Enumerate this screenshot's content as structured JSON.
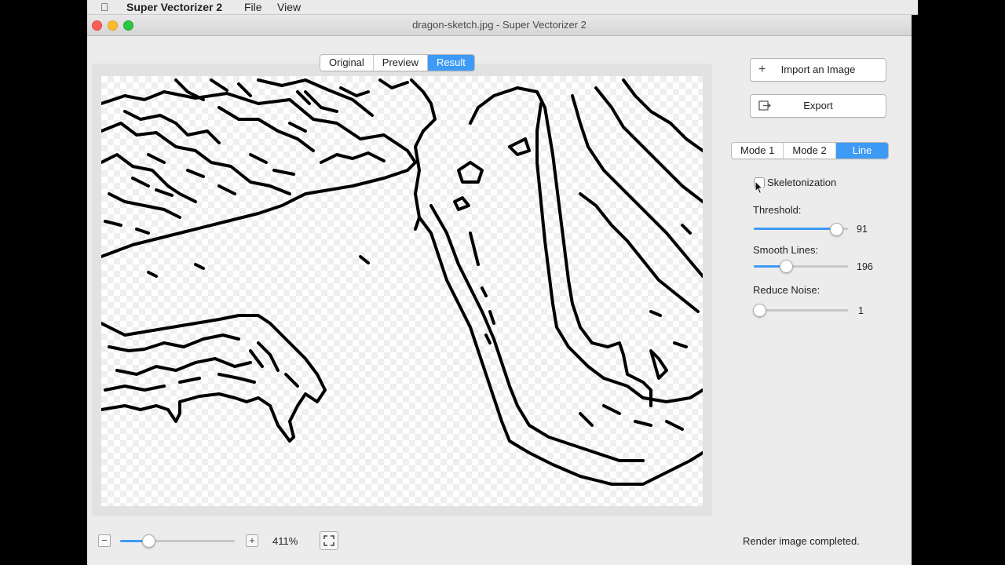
{
  "menubar": {
    "app_name": "Super Vectorizer 2",
    "menus": [
      "File",
      "View"
    ]
  },
  "window": {
    "title": "dragon-sketch.jpg - Super Vectorizer 2"
  },
  "view_tabs": {
    "items": [
      "Original",
      "Preview",
      "Result"
    ],
    "selected": "Result"
  },
  "actions": {
    "import_label": "Import an Image",
    "export_label": "Export"
  },
  "mode_tabs": {
    "items": [
      "Mode 1",
      "Mode 2",
      "Line"
    ],
    "selected": "Line"
  },
  "options": {
    "skeletonization_label": "Skeletonization",
    "skeletonization_checked": false,
    "threshold": {
      "label": "Threshold:",
      "value": "91",
      "fraction": 0.88
    },
    "smooth_lines": {
      "label": "Smooth Lines:",
      "value": "196",
      "fraction": 0.33
    },
    "reduce_noise": {
      "label": "Reduce Noise:",
      "value": "1",
      "fraction": 0.0
    }
  },
  "bottom": {
    "zoom_minus": "−",
    "zoom_plus": "+",
    "zoom_level": "411%",
    "zoom_fraction": 0.25,
    "status": "Render image completed."
  },
  "colors": {
    "accent": "#3d9af5",
    "close": "#fc5f57",
    "minimize": "#fdbc2e",
    "maximize": "#28c840"
  },
  "icons": [
    "apple-icon",
    "plus-icon",
    "export-icon",
    "minus-icon",
    "fit-screen-icon",
    "cursor-icon"
  ]
}
